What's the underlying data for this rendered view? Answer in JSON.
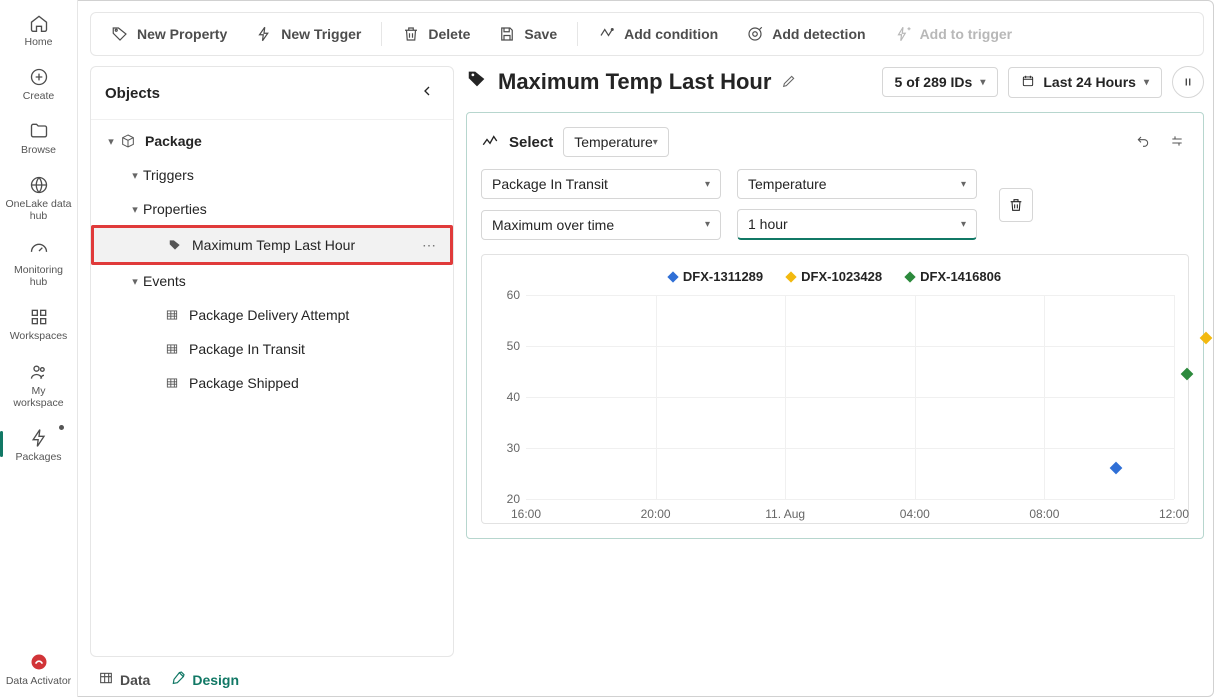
{
  "nav": [
    {
      "id": "home",
      "label": "Home"
    },
    {
      "id": "create",
      "label": "Create"
    },
    {
      "id": "browse",
      "label": "Browse"
    },
    {
      "id": "onelake",
      "label": "OneLake data hub"
    },
    {
      "id": "monitoring",
      "label": "Monitoring hub"
    },
    {
      "id": "workspaces",
      "label": "Workspaces"
    },
    {
      "id": "myworkspace",
      "label": "My workspace"
    },
    {
      "id": "packages",
      "label": "Packages"
    }
  ],
  "nav_bottom": {
    "id": "activator",
    "label": "Data Activator"
  },
  "toolbar": {
    "new_property": "New Property",
    "new_trigger": "New Trigger",
    "delete": "Delete",
    "save": "Save",
    "add_condition": "Add condition",
    "add_detection": "Add detection",
    "add_to_trigger": "Add to trigger"
  },
  "objects_panel": {
    "title": "Objects",
    "tree": {
      "package": "Package",
      "triggers": "Triggers",
      "properties": "Properties",
      "selected_property": "Maximum Temp Last Hour",
      "events": "Events",
      "event_items": [
        "Package Delivery Attempt",
        "Package In Transit",
        "Package Shipped"
      ]
    }
  },
  "bottom_tabs": {
    "data": "Data",
    "design": "Design"
  },
  "main": {
    "title": "Maximum Temp Last Hour",
    "ids_pill": "5 of 289 IDs",
    "time_pill": "Last 24 Hours",
    "select_label": "Select",
    "select_value": "Temperature",
    "filters": {
      "a": "Package In Transit",
      "b": "Temperature",
      "c": "Maximum over time",
      "d": "1 hour"
    }
  },
  "chart_data": {
    "type": "scatter",
    "ylim": [
      20,
      55
    ],
    "yticks": [
      20,
      30,
      40,
      50,
      60
    ],
    "xticks": [
      "16:00",
      "20:00",
      "11. Aug",
      "04:00",
      "08:00",
      "12:00"
    ],
    "series": [
      {
        "name": "DFX-1311289",
        "color": "#2f6fd6",
        "points": [
          {
            "xi": 4.55,
            "y": 26
          }
        ]
      },
      {
        "name": "DFX-1023428",
        "color": "#f2b90f",
        "points": [
          {
            "xi": 5.25,
            "y": 51.5
          }
        ]
      },
      {
        "name": "DFX-1416806",
        "color": "#2c8a3c",
        "points": [
          {
            "xi": 5.1,
            "y": 44.5
          }
        ]
      }
    ]
  }
}
